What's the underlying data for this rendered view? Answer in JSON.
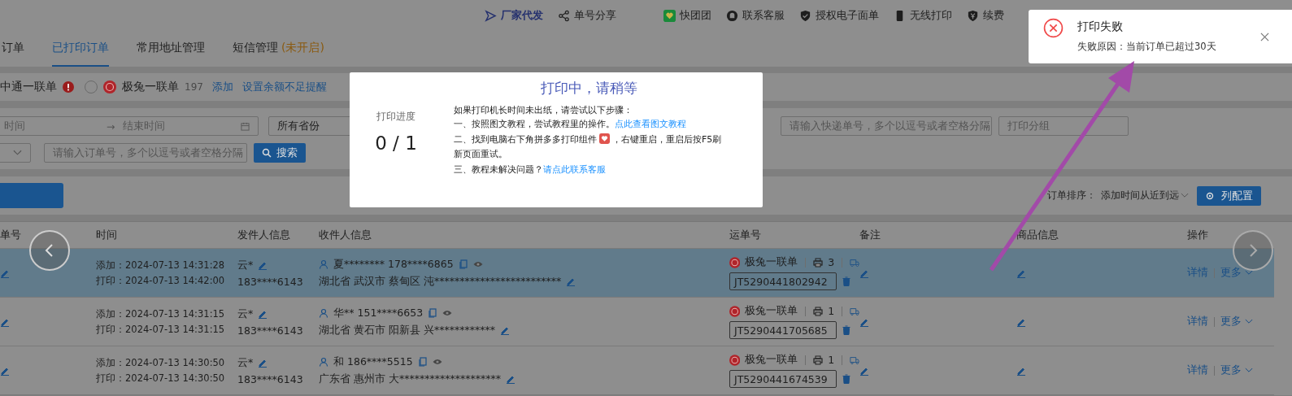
{
  "top_bar": {
    "items": [
      {
        "kind": "send",
        "label": "厂家代发"
      },
      {
        "kind": "share",
        "label": "单号分享"
      },
      {
        "kind": "group",
        "label": "快团团"
      },
      {
        "kind": "service",
        "label": "联系客服"
      },
      {
        "kind": "shield",
        "label": "授权电子面单"
      },
      {
        "kind": "phone",
        "label": "无线打印"
      },
      {
        "kind": "yen",
        "label": "续费"
      }
    ]
  },
  "tabs": [
    {
      "label": "订单",
      "selected": false
    },
    {
      "label": "已打印订单",
      "selected": true
    },
    {
      "label": "常用地址管理",
      "selected": false
    },
    {
      "label": "短信管理",
      "note": "(未开启)",
      "selected": false
    }
  ],
  "accounts": [
    {
      "name": "中通一联单",
      "warning": true
    },
    {
      "name": "极兔一联单",
      "selected": false,
      "count": "197"
    }
  ],
  "account_links": [
    "添加",
    "设置余额不足提醒"
  ],
  "filters": {
    "start_time": {
      "placeholder": "时间"
    },
    "date_separator": "→",
    "end_time": {
      "placeholder": "结束时间"
    },
    "province": {
      "value": "所有省份"
    },
    "waybill": {
      "placeholder": "请输入快递单号，多个以逗号或者空格分隔"
    },
    "print_group": {
      "placeholder": "打印分组"
    },
    "order": {
      "placeholder": "请输入订单号，多个以逗号或者空格分隔"
    },
    "search_button": "搜索"
  },
  "toolbar": {
    "sort_label": "订单排序：",
    "sort_value": "添加时间从近到远",
    "column_config": "列配置"
  },
  "table": {
    "columns": [
      "单号",
      "时间",
      "发件人信息",
      "收件人信息",
      "运单号",
      "备注",
      "商品信息",
      "操作"
    ],
    "rows": [
      {
        "selected": true,
        "add_time": "添加：2024-07-13 14:31:28",
        "print_time": "打印：2024-07-13 14:42:00",
        "sender_name": "云*",
        "sender_phone": "183****6143",
        "recipient": "夏******** 178****6865",
        "address": "湖北省 武汉市 蔡甸区 沌*************************",
        "carrier": "极兔一联单",
        "print_count": "3",
        "waybill": "JT5290441802942",
        "actions": [
          "详情",
          "更多"
        ]
      },
      {
        "selected": false,
        "add_time": "添加：2024-07-13 14:31:15",
        "print_time": "打印：2024-07-13 14:31:15",
        "sender_name": "云*",
        "sender_phone": "183****6143",
        "recipient": "华** 151****6653",
        "address": "湖北省 黄石市 阳新县 兴************",
        "carrier": "极兔一联单",
        "print_count": "1",
        "waybill": "JT5290441705685",
        "actions": [
          "详情",
          "更多"
        ]
      },
      {
        "selected": false,
        "add_time": "添加：2024-07-13 14:30:50",
        "print_time": "打印：2024-07-13 14:30:50",
        "sender_name": "云*",
        "sender_phone": "183****6143",
        "recipient": "和 186****5515",
        "address": "广东省 惠州市 大********************",
        "carrier": "极兔一联单",
        "print_count": "1",
        "waybill": "JT5290441674539",
        "actions": [
          "详情",
          "更多"
        ]
      }
    ]
  },
  "modal": {
    "title": "打印中，请稍等",
    "progress_label": "打印进度",
    "progress": "0 / 1",
    "intro": "如果打印机长时间未出纸，请尝试以下步骤：",
    "step1": "一、按照图文教程，尝试教程里的操作。",
    "step1_link": "点此查看图文教程",
    "step2_before": "二、找到电脑右下角拼多多打印组件",
    "step2_after": "，右键重启，重启后按F5刷",
    "step2_cont": "新页面重试。",
    "step3": "三、教程未解决问题？",
    "step3_link": "请点此联系客服"
  },
  "toast": {
    "title": "打印失败",
    "message": "失败原因：当前订单已超过30天"
  }
}
